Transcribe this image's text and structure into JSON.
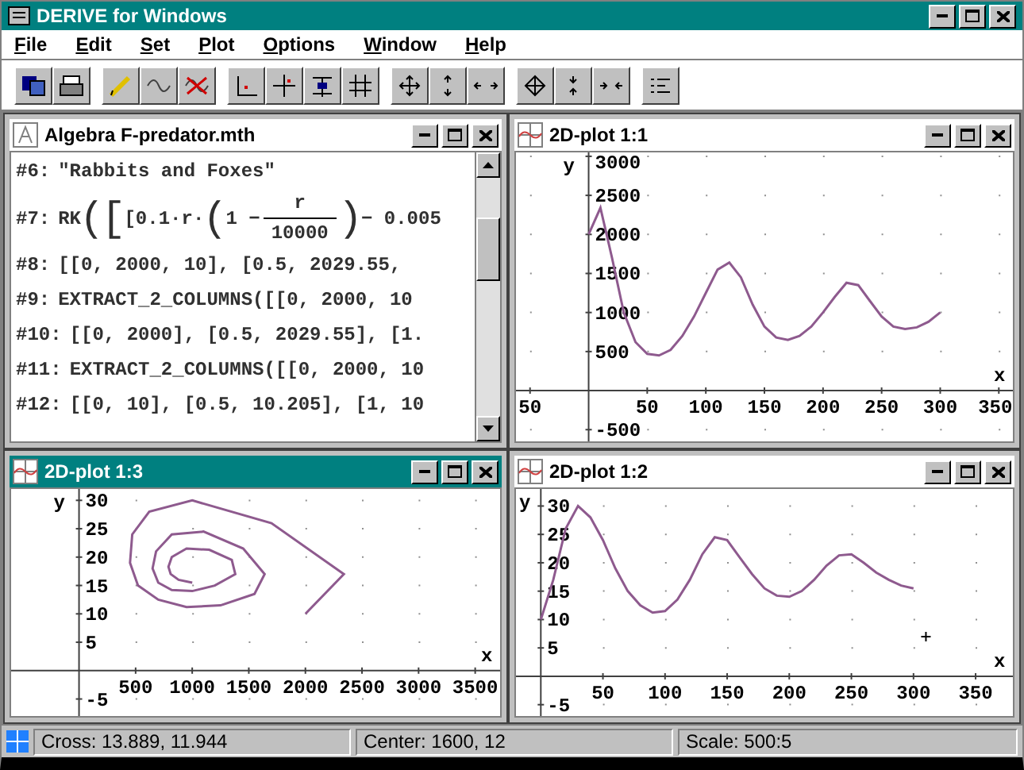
{
  "window": {
    "title": "DERIVE for Windows"
  },
  "menu": [
    "File",
    "Edit",
    "Set",
    "Plot",
    "Options",
    "Window",
    "Help"
  ],
  "algebra": {
    "title": "Algebra  F-predator.mth",
    "active": false,
    "lines": [
      {
        "label": "#6:",
        "kind": "text",
        "text": "\"Rabbits and Foxes\""
      },
      {
        "label": "#7:",
        "kind": "formula",
        "pieces": [
          {
            "kind": "text",
            "text": "RK"
          },
          {
            "kind": "big",
            "text": "("
          },
          {
            "kind": "big",
            "text": "["
          },
          {
            "kind": "text",
            "text": "[0.1·r·"
          },
          {
            "kind": "big",
            "text": "("
          },
          {
            "kind": "text",
            "text": "1 −"
          },
          {
            "kind": "frac",
            "numerator": "r",
            "denominator": "10000"
          },
          {
            "kind": "big",
            "text": ")"
          },
          {
            "kind": "text",
            "text": "− 0.005"
          }
        ]
      },
      {
        "label": "#8:",
        "kind": "text",
        "text": "[[0, 2000, 10], [0.5, 2029.55,"
      },
      {
        "label": "#9:",
        "kind": "text",
        "text": "EXTRACT_2_COLUMNS([[0, 2000, 10"
      },
      {
        "label": "#10:",
        "kind": "text",
        "text": "[[0, 2000], [0.5, 2029.55], [1."
      },
      {
        "label": "#11:",
        "kind": "text",
        "text": "EXTRACT_2_COLUMNS([[0, 2000, 10"
      },
      {
        "label": "#12:",
        "kind": "text",
        "text": "[[0, 10], [0.5, 10.205], [1, 10"
      }
    ]
  },
  "plots": [
    {
      "title": "2D-plot 1:1",
      "active": false,
      "chart_data": {
        "type": "line",
        "xlabel": "x",
        "ylabel": "y",
        "x": [
          0,
          10,
          20,
          30,
          40,
          50,
          60,
          70,
          80,
          90,
          100,
          110,
          120,
          130,
          140,
          150,
          160,
          170,
          180,
          190,
          200,
          210,
          220,
          230,
          240,
          250,
          260,
          270,
          280,
          290,
          300
        ],
        "series": [
          {
            "color": "#8e5a8e",
            "values": [
              2000,
              2340,
              1700,
              1000,
              620,
              470,
              450,
              520,
              700,
              950,
              1250,
              1550,
              1640,
              1450,
              1100,
              820,
              680,
              650,
              700,
              820,
              1000,
              1200,
              1380,
              1350,
              1150,
              950,
              820,
              790,
              810,
              880,
              1000
            ]
          }
        ],
        "xlim": [
          -62,
          362
        ],
        "ylim": [
          -650,
          3050
        ],
        "xticks": [
          {
            "value": -50,
            "label": "50"
          },
          50,
          100,
          150,
          200,
          250,
          300,
          350
        ],
        "yticks": [
          -500,
          500,
          1000,
          1500,
          2000,
          2500,
          3000
        ]
      }
    },
    {
      "title": "2D-plot 1:3",
      "active": true,
      "chart_data": {
        "type": "line",
        "xlabel": "x",
        "ylabel": "y",
        "x": [
          2000,
          2340,
          1700,
          1000,
          620,
          470,
          450,
          520,
          700,
          950,
          1250,
          1550,
          1640,
          1450,
          1100,
          820,
          680,
          650,
          700,
          820,
          1000,
          1200,
          1380,
          1350,
          1150,
          950,
          820,
          790,
          810,
          880,
          1000
        ],
        "series": [
          {
            "color": "#8e5a8e",
            "values": [
              10,
              17,
              26,
              30,
              28,
              24,
              19,
              15,
              12.5,
              11.2,
              11.5,
              13.5,
              17,
              21.5,
              24.5,
              24,
              21,
              18,
              15.5,
              14.2,
              14,
              15,
              17,
              19.5,
              21.3,
              21.5,
              20,
              18.3,
              17,
              16,
              15.5
            ]
          }
        ],
        "xlim": [
          -600,
          3720
        ],
        "ylim": [
          -8,
          32
        ],
        "xticks": [
          500,
          1000,
          1500,
          2000,
          2500,
          3000,
          3500
        ],
        "yticks": [
          -5,
          5,
          10,
          15,
          20,
          25,
          30
        ]
      }
    },
    {
      "title": "2D-plot 1:2",
      "active": false,
      "chart_data": {
        "type": "line",
        "xlabel": "x",
        "ylabel": "y",
        "x": [
          0,
          10,
          20,
          30,
          40,
          50,
          60,
          70,
          80,
          90,
          100,
          110,
          120,
          130,
          140,
          150,
          160,
          170,
          180,
          190,
          200,
          210,
          220,
          230,
          240,
          250,
          260,
          270,
          280,
          290,
          300
        ],
        "series": [
          {
            "color": "#8e5a8e",
            "values": [
              10,
              17,
              26,
              30,
              28,
              24,
              19,
              15,
              12.5,
              11.2,
              11.5,
              13.5,
              17,
              21.5,
              24.5,
              24,
              21,
              18,
              15.5,
              14.2,
              14,
              15,
              17,
              19.5,
              21.3,
              21.5,
              20,
              18.3,
              17,
              16,
              15.5
            ]
          }
        ],
        "xlim": [
          -20,
          380
        ],
        "ylim": [
          -7,
          33
        ],
        "xticks": [
          50,
          100,
          150,
          200,
          250,
          300,
          350
        ],
        "yticks": [
          -5,
          5,
          10,
          15,
          20,
          25,
          30
        ]
      }
    }
  ],
  "status_bar": [
    "Cross: 13.889, 11.944",
    "Center: 1600, 12",
    "Scale: 500:5"
  ]
}
